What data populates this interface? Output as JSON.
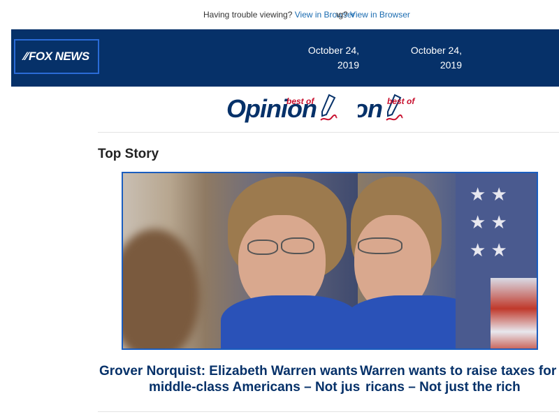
{
  "pre_header": {
    "left_text": "Having trouble viewing?",
    "left_link": "View in Browser",
    "right_text": "viewing?",
    "right_link": "View in Browser"
  },
  "header": {
    "logo": "FOX NEWS",
    "date_left": "October 24, 2019",
    "date_right_line1": "October 24,",
    "date_right_line2": "2019",
    "bg_color": "#063169"
  },
  "banner": {
    "opinion_word": "Opinion",
    "opinion_word_right": "inion",
    "best_of": "best of"
  },
  "section": {
    "title": "Top Story"
  },
  "story": {
    "image_alt": "Elizabeth Warren",
    "headline_left_1": "Grover Norquist: Elizabeth Warren wants t",
    "headline_left_2": "middle-class Americans – Not jus",
    "headline_right_1": "Warren wants to raise taxes for",
    "headline_right_2": "ricans – Not just the rich"
  },
  "colors": {
    "link": "#1a6bb0",
    "navy": "#063169",
    "accent_red": "#c8102e",
    "image_border": "#1a5dbf"
  }
}
